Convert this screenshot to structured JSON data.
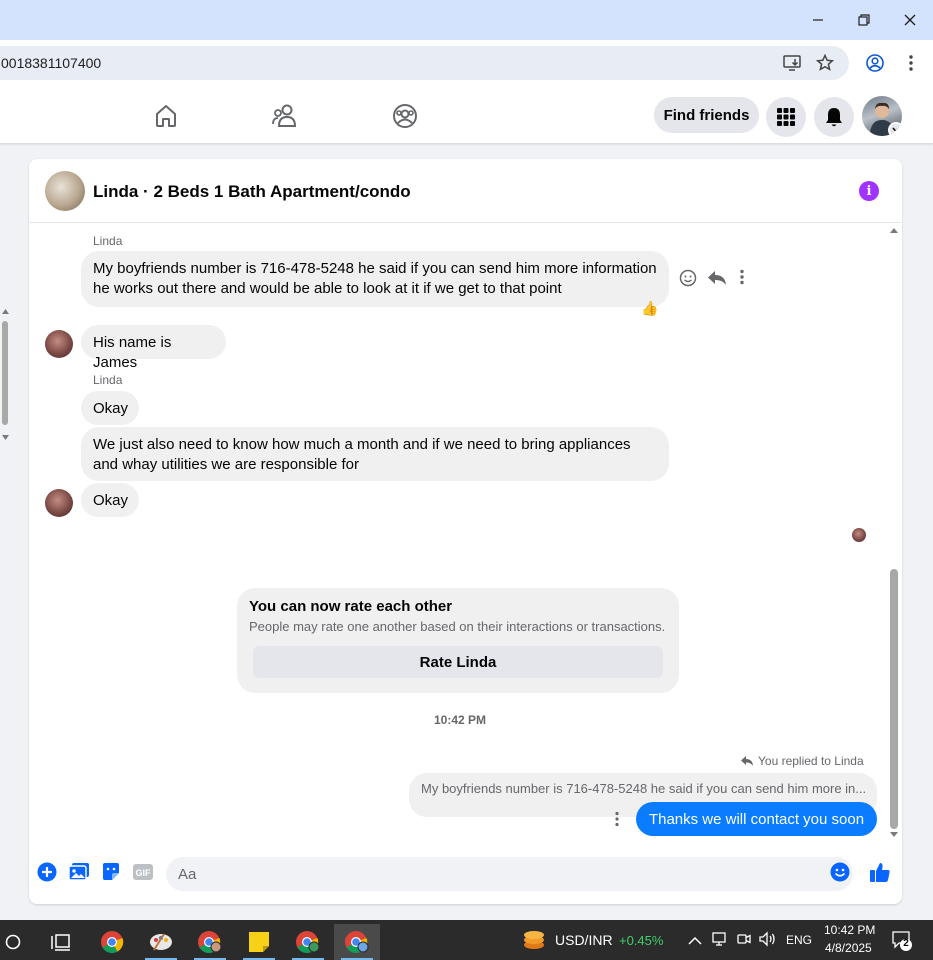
{
  "browser": {
    "url": "0018381107400",
    "window_controls": {
      "minimize": "minimize-icon",
      "restore": "restore-icon",
      "close": "close-icon"
    }
  },
  "nav": {
    "find_friends_label": "Find friends",
    "icons": [
      "home-icon",
      "friends-icon",
      "groups-icon",
      "menu-grid-icon",
      "notifications-icon"
    ]
  },
  "chat": {
    "title": "Linda · 2 Beds 1 Bath Apartment/condo",
    "messages": [
      {
        "sender": "Linda",
        "text": "My boyfriends number is 716-478-5248 he said if you can send him more information he works out there and would be able to look at it if we get to that point",
        "reaction": "👍"
      },
      {
        "text": "His name is James"
      },
      {
        "sender": "Linda",
        "text": "Okay"
      },
      {
        "text": "We just also need to know how much a month and if we need to bring appliances and whay utilities we are responsible for"
      },
      {
        "text": "Okay"
      }
    ],
    "rate_card": {
      "title": "You can now rate each other",
      "subtitle": "People may rate one another based on their interactions or transactions.",
      "button": "Rate Linda"
    },
    "timestamp": "10:42 PM",
    "reply_label": "You replied to Linda",
    "quoted_text": "My boyfriends number is 716-478-5248 he said if you can send him more in...",
    "sent_text": "Thanks we will contact you soon",
    "composer_placeholder": "Aa"
  },
  "taskbar": {
    "ticker_label": "USD/INR",
    "ticker_change": "+0.45%",
    "language": "ENG",
    "time": "10:42 PM",
    "date": "4/8/2025",
    "notification_count": "2"
  },
  "colors": {
    "accent": "#0a7cff",
    "info": "#a033ff",
    "ticker_up": "#3fcf6a"
  }
}
